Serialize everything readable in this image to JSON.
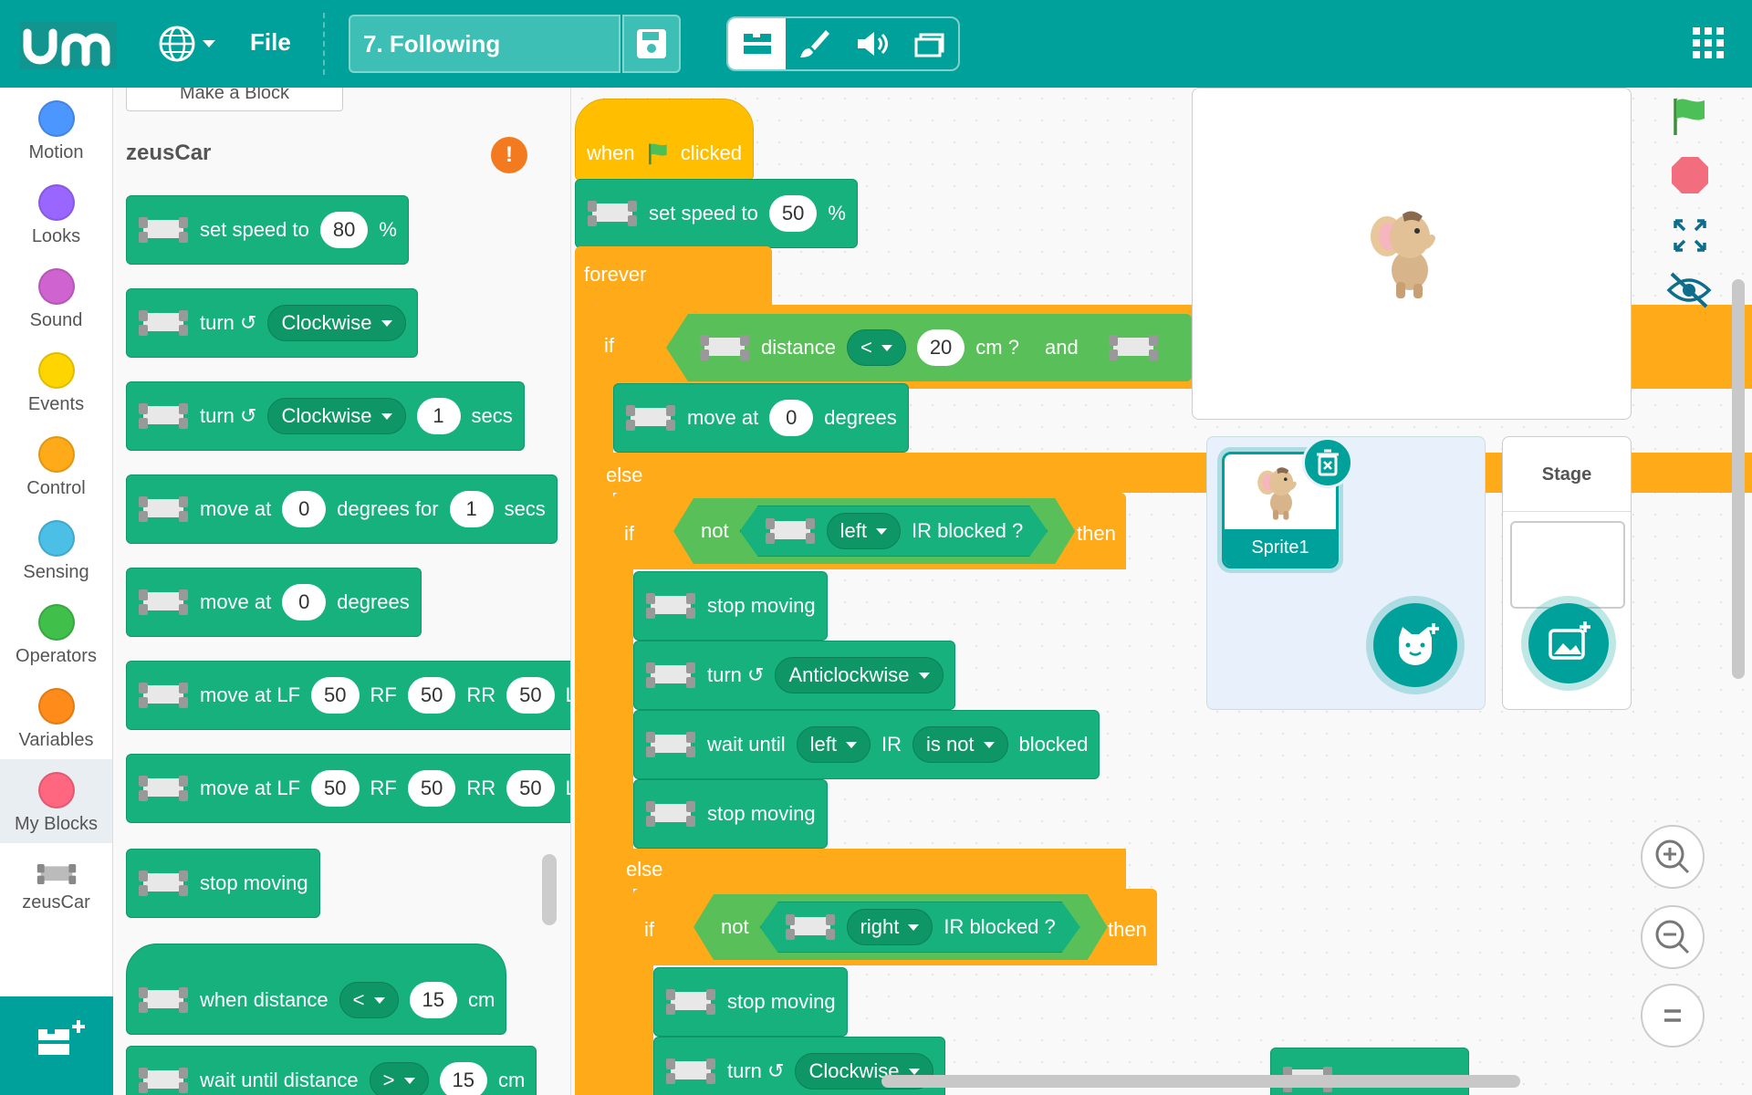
{
  "topbar": {
    "file_label": "File",
    "project_name": "7. Following"
  },
  "categories": [
    {
      "label": "Motion",
      "color": "#4c97ff"
    },
    {
      "label": "Looks",
      "color": "#9966ff"
    },
    {
      "label": "Sound",
      "color": "#cf63cf"
    },
    {
      "label": "Events",
      "color": "#ffd500"
    },
    {
      "label": "Control",
      "color": "#ffab19"
    },
    {
      "label": "Sensing",
      "color": "#4cbfe6"
    },
    {
      "label": "Operators",
      "color": "#40bf4a"
    },
    {
      "label": "Variables",
      "color": "#ff8c1a"
    },
    {
      "label": "My Blocks",
      "color": "#ff6680"
    },
    {
      "label": "zeusCar",
      "color": ""
    }
  ],
  "palette": {
    "make_block": "Make a Block",
    "title": "zeusCar",
    "b1": {
      "t1": "set speed to",
      "v1": "80",
      "t2": "%"
    },
    "b2": {
      "t1": "turn ↺",
      "d1": "Clockwise"
    },
    "b3": {
      "t1": "turn ↺",
      "d1": "Clockwise",
      "v1": "1",
      "t2": "secs"
    },
    "b4": {
      "t1": "move at",
      "v1": "0",
      "t2": "degrees for",
      "v2": "1",
      "t3": "secs"
    },
    "b5": {
      "t1": "move at",
      "v1": "0",
      "t2": "degrees"
    },
    "b6": {
      "t1": "move at LF",
      "v1": "50",
      "t2": "RF",
      "v2": "50",
      "t3": "RR",
      "v3": "50",
      "t4": "L"
    },
    "b7": {
      "t1": "move at LF",
      "v1": "50",
      "t2": "RF",
      "v2": "50",
      "t3": "RR",
      "v3": "50",
      "t4": "L"
    },
    "b8": {
      "t1": "stop moving"
    },
    "b9": {
      "t1": "when distance",
      "d1": "<",
      "v1": "15",
      "t2": "cm"
    },
    "b10": {
      "t1": "wait until distance",
      "d1": ">",
      "v1": "15",
      "t2": "cm"
    }
  },
  "script": {
    "when": "when",
    "clicked": "clicked",
    "setspeed": {
      "t1": "set speed to",
      "v1": "50",
      "t2": "%"
    },
    "forever": "forever",
    "if1": {
      "if": "if",
      "distance": "distance",
      "op": "<",
      "v": "20",
      "cm": "cm ?",
      "and": "and"
    },
    "move0": {
      "t1": "move at",
      "v1": "0",
      "t2": "degrees"
    },
    "else1": "else",
    "if2": {
      "if": "if",
      "not": "not",
      "side": "left",
      "ir": "IR blocked ?",
      "then": "then"
    },
    "stop1": "stop moving",
    "turnanti": {
      "t1": "turn ↺",
      "d1": "Anticlockwise"
    },
    "waituntil": {
      "t1": "wait until",
      "d1": "left",
      "t2": "IR",
      "d2": "is not",
      "t3": "blocked"
    },
    "stop2": "stop moving",
    "else2": "else",
    "if3": {
      "if": "if",
      "not": "not",
      "side": "right",
      "ir": "IR blocked ?",
      "then": "then"
    },
    "stop3": "stop moving",
    "turncw": {
      "t1": "turn ↺",
      "d1": "Clockwise"
    }
  },
  "sprites": {
    "sprite1": "Sprite1",
    "stage_label": "Stage"
  }
}
